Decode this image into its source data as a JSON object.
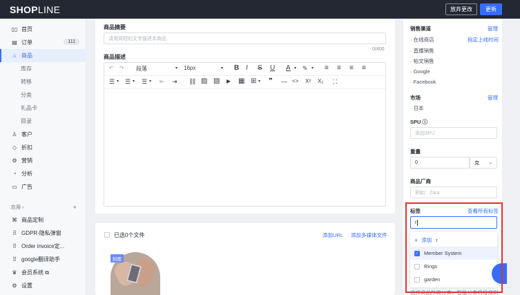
{
  "topbar": {
    "logo_bold": "SHOP",
    "logo_light": "LINE",
    "discard": "放弃更改",
    "update": "更新"
  },
  "sidebar": {
    "items": [
      {
        "icon": "home-icon",
        "glyph": "▯▯",
        "label": "首页"
      },
      {
        "icon": "order-icon",
        "glyph": "▤",
        "label": "订单",
        "badge": "111"
      },
      {
        "icon": "bag-icon",
        "glyph": "⌂",
        "label": "商品"
      },
      {
        "label": "库存"
      },
      {
        "label": "转移"
      },
      {
        "label": "分类"
      },
      {
        "label": "礼品卡"
      },
      {
        "label": "目录"
      },
      {
        "icon": "user-icon",
        "glyph": "♙",
        "label": "客户"
      },
      {
        "icon": "discount-icon",
        "glyph": "◇",
        "label": "折扣"
      },
      {
        "icon": "marketing-icon",
        "glyph": "⚙",
        "label": "营销"
      },
      {
        "icon": "analytics-icon",
        "glyph": "◔",
        "label": "分析"
      },
      {
        "icon": "ads-icon",
        "glyph": "▭",
        "label": "广告"
      }
    ],
    "apps_label": "应用 ›",
    "apps_plus": "+",
    "apps": [
      {
        "icon": "app-icon",
        "glyph": "⌘",
        "label": "商品定制"
      },
      {
        "icon": "app-icon",
        "glyph": "⠿",
        "label": "GDPR-隐私弹窗"
      },
      {
        "icon": "app-icon",
        "glyph": "⠿",
        "label": "Order invoice定..."
      },
      {
        "icon": "app-icon",
        "glyph": "⠿",
        "label": "google翻译助手"
      },
      {
        "icon": "member-icon",
        "glyph": "♛",
        "label": "会员系统 ⧉"
      },
      {
        "icon": "settings-icon",
        "glyph": "⚙",
        "label": "设置"
      }
    ]
  },
  "product": {
    "summary_label": "商品摘要",
    "summary_placeholder": "请用简短的文字描述本商品",
    "summary_counter": "0/400",
    "desc_label": "商品描述",
    "toolbar": {
      "undo": "↶",
      "redo": "↷",
      "paragraph": "段落",
      "font_size": "16px",
      "caret": "▾",
      "bold": "B",
      "italic": "I",
      "strike": "S",
      "underline": "U",
      "font_color": "A",
      "highlight": "✎",
      "align_left": "≡",
      "align_center": "≡",
      "align_right": "≡",
      "justify": "≡",
      "list_ordered": "☰",
      "list_bullet": "☰",
      "list_check": "☰",
      "indent_out": "⇤",
      "indent_in": "⇥",
      "link": "⛓",
      "image": "▨",
      "gallery": "▧",
      "video": "▶",
      "media": "▦",
      "table": "⊞",
      "quote": "❞",
      "hr": "—",
      "code": "<>",
      "superscript": "X²",
      "subscript": "X₂",
      "fullscreen": "⛶"
    }
  },
  "files": {
    "select_all": "已选0个文件",
    "add_url": "添加URL",
    "add_media": "添加多媒体文件",
    "cover_tag": "封面"
  },
  "right": {
    "channels_label": "销售渠道",
    "manage": "管理",
    "channels": [
      "· 在线商店",
      "· 直播销售",
      "· 帖文销售",
      "· Google",
      "· Facebook"
    ],
    "schedule_link": "指定上线时间",
    "market_label": "市场",
    "market_value": "· 日本",
    "spu_label": "SPU ⓘ",
    "spu_placeholder": "添加SPU",
    "weight_label": "重量",
    "weight_value": "0",
    "weight_unit": "克",
    "vendor_label": "商品厂商",
    "vendor_placeholder": "例如：Zara",
    "tags_label": "标签",
    "view_all_tags": "查看所有标签",
    "tags_input": "r",
    "add_prefix": "+",
    "add_text": "添加",
    "add_query": "r",
    "options": [
      {
        "label": "Member System",
        "checked": true
      },
      {
        "label": "Rings",
        "checked": false
      },
      {
        "label": "garden",
        "checked": false
      }
    ],
    "bottom_hint": "选择商品所属分类，智能分类将按规则"
  },
  "colors": {
    "accent": "#356dff",
    "topbar": "#242833",
    "highlight_box": "#e0302c"
  }
}
